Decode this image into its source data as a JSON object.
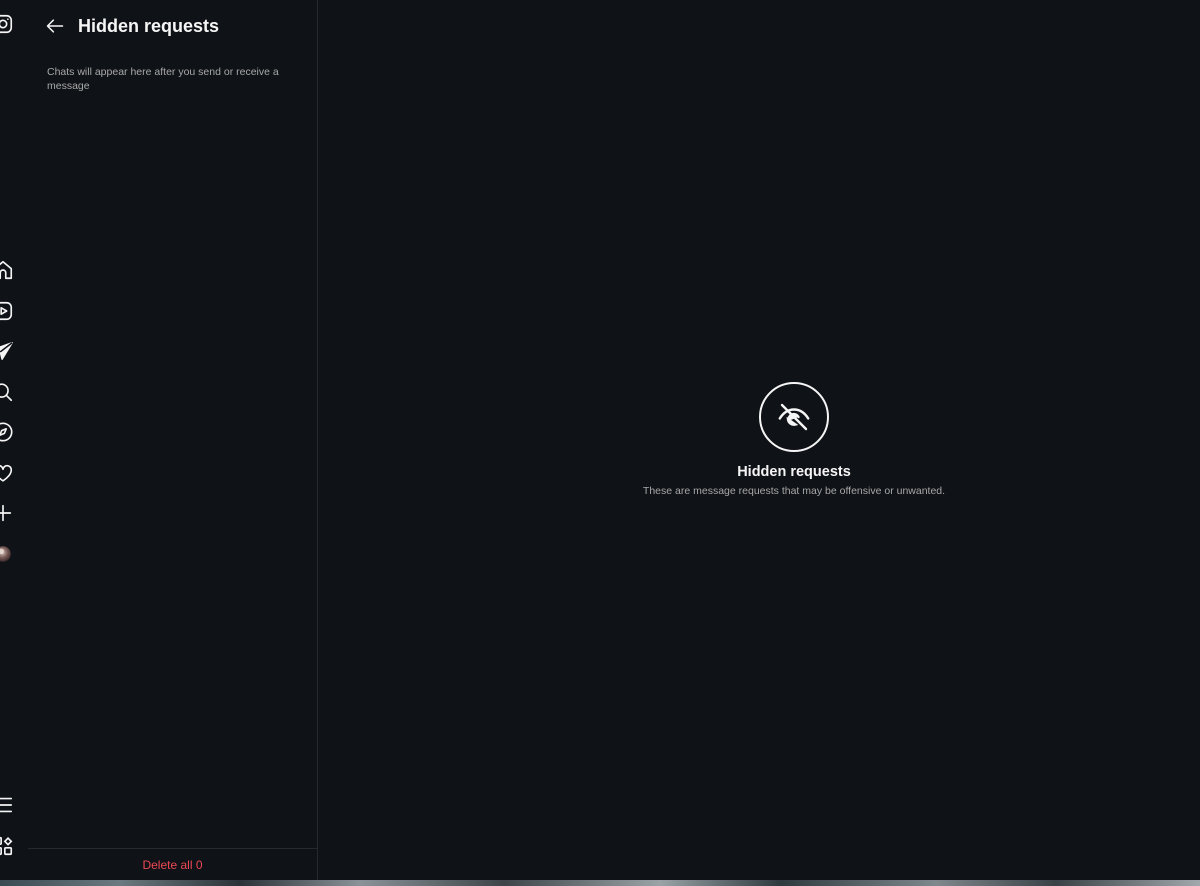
{
  "nav": {
    "items": [
      {
        "name": "instagram-logo-icon",
        "icon": "instagram"
      },
      {
        "name": "home-icon",
        "icon": "home"
      },
      {
        "name": "reels-icon",
        "icon": "reels"
      },
      {
        "name": "messages-icon",
        "icon": "direct"
      },
      {
        "name": "search-icon",
        "icon": "search"
      },
      {
        "name": "explore-icon",
        "icon": "compass"
      },
      {
        "name": "notifications-icon",
        "icon": "heart"
      },
      {
        "name": "create-icon",
        "icon": "plus"
      },
      {
        "name": "profile-avatar",
        "icon": "avatar"
      },
      {
        "name": "menu-icon",
        "icon": "hamburger"
      },
      {
        "name": "apps-icon",
        "icon": "grid"
      }
    ]
  },
  "list_panel": {
    "title": "Hidden requests",
    "empty_hint": "Chats will appear here after you send or receive a message",
    "delete_all_label": "Delete all 0"
  },
  "main": {
    "empty_title": "Hidden requests",
    "empty_subtitle": "These are message requests that may be offensive or unwanted.",
    "icon": "eye-off-icon"
  },
  "colors": {
    "background": "#0f1216",
    "danger": "#ed4956",
    "text_secondary": "#a8a8a8"
  }
}
